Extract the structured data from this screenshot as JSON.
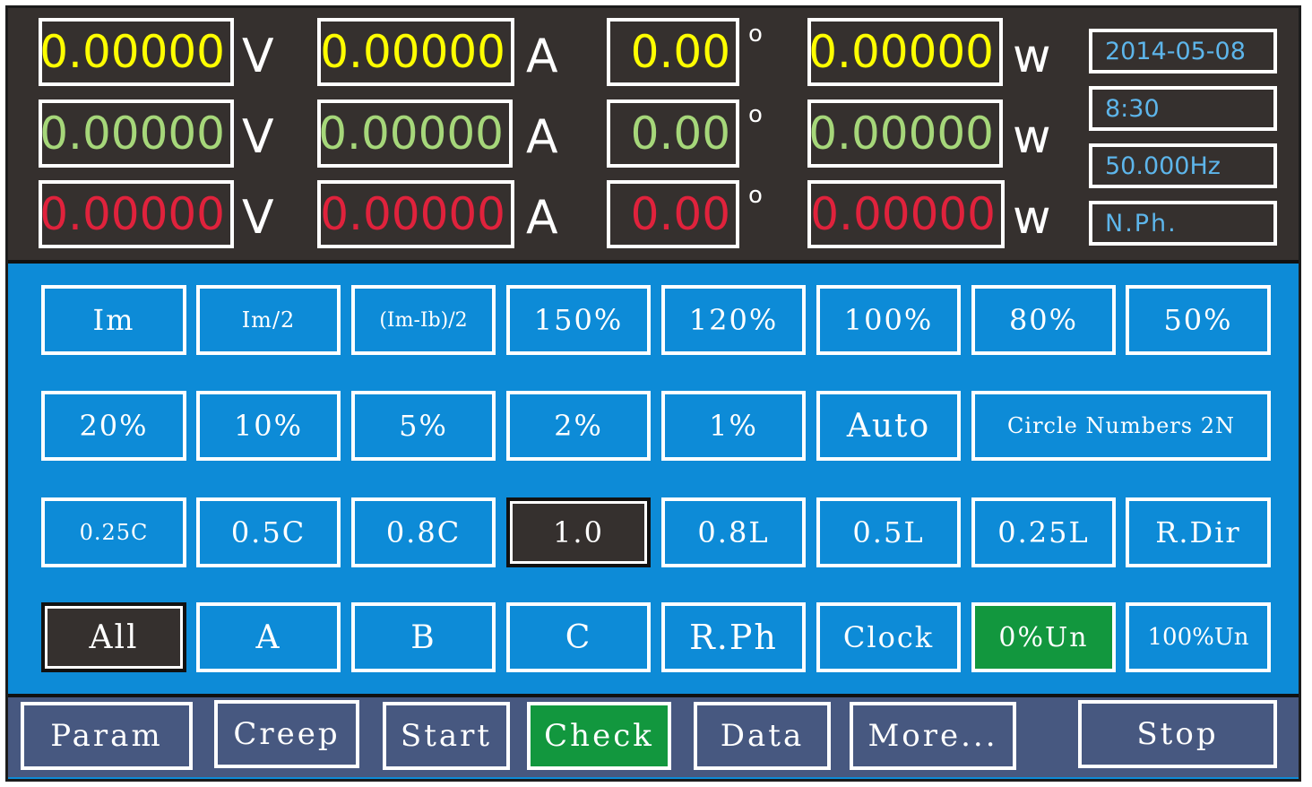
{
  "readout": {
    "rows": [
      {
        "voltage": "0.00000",
        "current": "0.00000",
        "angle": "0.00",
        "power": "0.00000"
      },
      {
        "voltage": "0.00000",
        "current": "0.00000",
        "angle": "0.00",
        "power": "0.00000"
      },
      {
        "voltage": "0.00000",
        "current": "0.00000",
        "angle": "0.00",
        "power": "0.00000"
      }
    ],
    "units": {
      "voltage": "V",
      "current": "A",
      "angle": "o",
      "power": "w"
    },
    "phase_colors": [
      "#ffff00",
      "#a6d77a",
      "#e0223c"
    ]
  },
  "info": {
    "date": "2014-05-08",
    "time": "8:30",
    "frequency": "50.000Hz",
    "mode": "N.Ph."
  },
  "grid": {
    "row1": [
      "Im",
      "Im/2",
      "(Im-Ib)/2",
      "150%",
      "120%",
      "100%",
      "80%",
      "50%"
    ],
    "row2": [
      "20%",
      "10%",
      "5%",
      "2%",
      "1%",
      "Auto",
      "Circle Numbers 2N"
    ],
    "row3": [
      "0.25C",
      "0.5C",
      "0.8C",
      "1.0",
      "0.8L",
      "0.5L",
      "0.25L",
      "R.Dir"
    ],
    "row4": [
      "All",
      "A",
      "B",
      "C",
      "R.Ph",
      "Clock",
      "0%Un",
      "100%Un"
    ],
    "selected": {
      "power_factor": "1.0",
      "phase": "All",
      "voltage_level": "0%Un"
    }
  },
  "bottom": {
    "buttons": [
      "Param",
      "Creep",
      "Start",
      "Check",
      "Data",
      "More...",
      "Stop"
    ],
    "active": "Check"
  },
  "colors": {
    "panel_dark": "#35302e",
    "panel_blue": "#0d8bd7",
    "bar_slate": "#475880",
    "active_green": "#12973e",
    "info_text": "#5db5ea"
  }
}
